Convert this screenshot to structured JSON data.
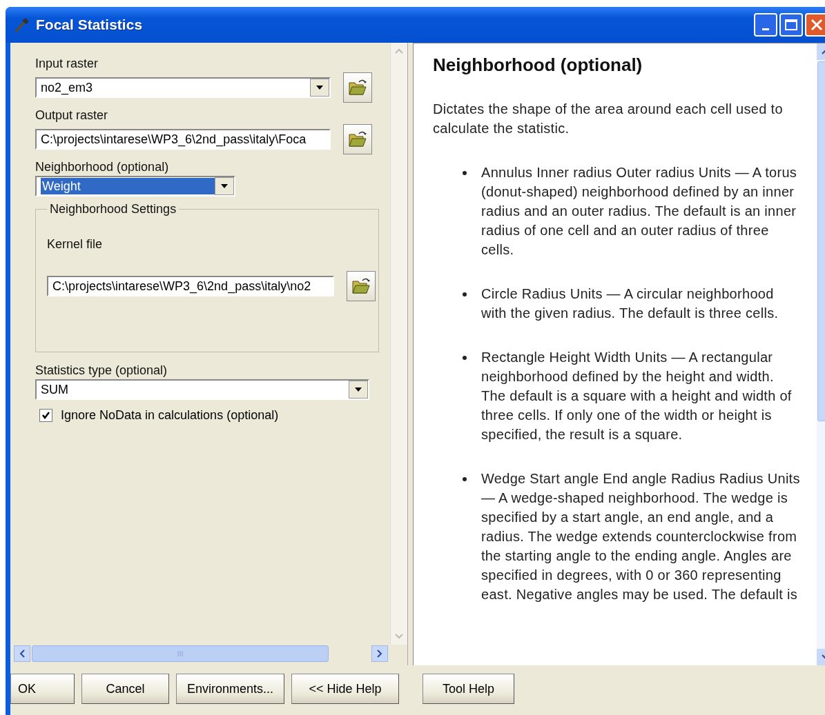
{
  "window": {
    "title": "Focal Statistics"
  },
  "fields": [
    {
      "kind": "combo",
      "label": "Input raster",
      "value": "no2_em3",
      "browse": true
    },
    {
      "kind": "text",
      "label": "Output raster",
      "value": "C:\\projects\\intarese\\WP3_6\\2nd_pass\\italy\\Foca",
      "browse": true
    },
    {
      "kind": "combo_short",
      "label": "Neighborhood (optional)",
      "value": "Weight",
      "highlighted": true
    },
    {
      "kind": "group",
      "title": "Neighborhood Settings",
      "fields": [
        {
          "kind": "text",
          "label": "Kernel file",
          "value": "C:\\projects\\intarese\\WP3_6\\2nd_pass\\italy\\no2",
          "browse": true
        }
      ]
    },
    {
      "kind": "combo",
      "label": "Statistics type (optional)",
      "value": "SUM",
      "browse": false
    },
    {
      "kind": "checkbox",
      "label": "Ignore NoData in calculations (optional)",
      "checked": true
    }
  ],
  "help": {
    "title": "Neighborhood (optional)",
    "intro": "Dictates the shape of the area around each cell used to calculate the statistic.",
    "bullets": [
      "Annulus Inner radius Outer radius Units — A torus (donut-shaped) neighborhood defined by an inner radius and an outer radius. The default is an inner radius of one cell and an outer radius of three cells.",
      "Circle Radius Units — A circular neighborhood with the given radius. The default is three cells.",
      "Rectangle Height Width Units — A rectangular neighborhood defined by the height and width. The default is a square with a height and width of three cells. If only one of the width or height is specified, the result is a square.",
      "Wedge Start angle End angle Radius Radius Units — A wedge-shaped neighborhood. The wedge is specified by a start angle, an end angle, and a radius. The wedge extends counterclockwise from the starting angle to the ending angle. Angles are specified in degrees, with 0 or 360 representing east. Negative angles may be used. The default is"
    ]
  },
  "buttons": [
    {
      "label": "OK"
    },
    {
      "label": "Cancel"
    },
    {
      "label": "Environments..."
    },
    {
      "label": "<< Hide Help"
    },
    {
      "label": "Tool Help"
    }
  ]
}
